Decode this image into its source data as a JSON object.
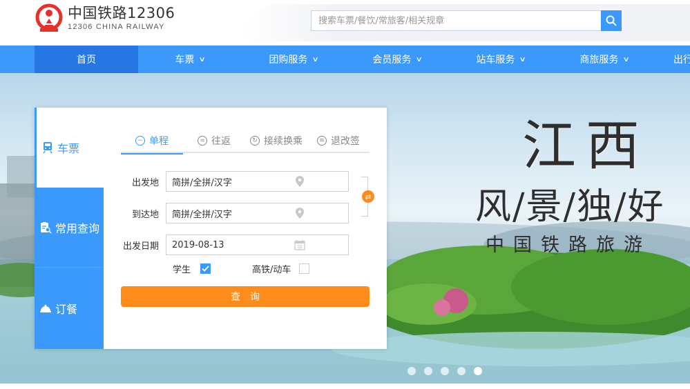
{
  "brand": {
    "name_cn": "中国铁路12306",
    "name_en": "12306 CHINA RAILWAY",
    "logo_icon": "railway-logo-icon",
    "logo_color": "#e5312a"
  },
  "search": {
    "placeholder": "搜索车票/餐饮/常旅客/相关规章",
    "icon": "search-icon"
  },
  "nav": {
    "items": [
      {
        "label": "首页",
        "active": true
      },
      {
        "label": "车票",
        "has_dropdown": true
      },
      {
        "label": "团购服务",
        "has_dropdown": true
      },
      {
        "label": "会员服务",
        "has_dropdown": true
      },
      {
        "label": "站车服务",
        "has_dropdown": true
      },
      {
        "label": "商旅服务",
        "has_dropdown": true
      },
      {
        "label": "出行"
      }
    ]
  },
  "booking": {
    "side_tabs": [
      {
        "label": "车票",
        "icon": "train-icon",
        "active": true
      },
      {
        "label": "常用查询",
        "icon": "clipboard-search-icon"
      },
      {
        "label": "订餐",
        "icon": "food-cloche-icon"
      }
    ],
    "trip_tabs": [
      {
        "label": "单程",
        "icon": "minus-circle-icon",
        "active": true
      },
      {
        "label": "往返",
        "icon": "equals-circle-icon"
      },
      {
        "label": "接续换乘",
        "icon": "refresh-circle-icon"
      },
      {
        "label": "退改签",
        "icon": "list-circle-icon"
      }
    ],
    "from": {
      "label": "出发地",
      "placeholder": "简拼/全拼/汉字",
      "icon": "location-pin-icon"
    },
    "to": {
      "label": "到达地",
      "placeholder": "简拼/全拼/汉字",
      "icon": "location-pin-icon"
    },
    "date": {
      "label": "出发日期",
      "value": "2019-08-13",
      "icon": "calendar-icon"
    },
    "student": {
      "label": "学生",
      "checked": true
    },
    "high_speed": {
      "label": "高铁/动车",
      "checked": false
    },
    "query_label": "查询",
    "swap_icon": "swap-arrows-icon"
  },
  "banner": {
    "title": "江西",
    "subtitle": "风/景/独/好",
    "tagline": "中国铁路旅游",
    "slides": 5,
    "active_slide": 5
  },
  "colors": {
    "primary": "#3b99fc",
    "nav_active": "#2676e3",
    "accent_orange": "#ff8c1a"
  }
}
